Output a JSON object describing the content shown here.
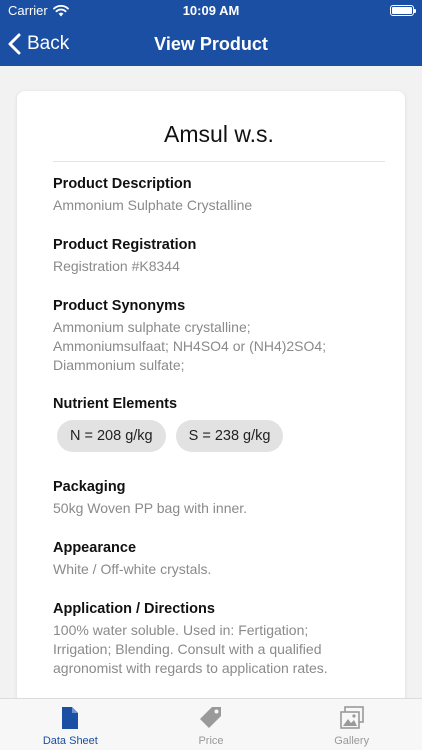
{
  "status_bar": {
    "carrier": "Carrier",
    "time": "10:09 AM"
  },
  "nav": {
    "back_label": "Back",
    "title": "View Product"
  },
  "product": {
    "name": "Amsul w.s.",
    "sections": {
      "description": {
        "label": "Product Description",
        "value": "Ammonium Sulphate Crystalline"
      },
      "registration": {
        "label": "Product Registration",
        "value": "Registration #K8344"
      },
      "synonyms": {
        "label": "Product Synonyms",
        "lines": [
          "Ammonium sulphate crystalline;",
          "Ammoniumsulfaat; NH4SO4 or (NH4)2SO4;",
          "Diammonium sulfate;"
        ]
      },
      "nutrients": {
        "label": "Nutrient Elements",
        "items": [
          "N = 208 g/kg",
          "S = 238 g/kg"
        ]
      },
      "packaging": {
        "label": "Packaging",
        "value": "50kg Woven PP bag with inner."
      },
      "appearance": {
        "label": "Appearance",
        "value": "White / Off-white crystals."
      },
      "application": {
        "label": "Application / Directions",
        "lines": [
          "100% water soluble. Used in: Fertigation;",
          "Irrigation; Blending. Consult with a qualified",
          "agronomist with regards to application rates."
        ]
      }
    }
  },
  "tabs": [
    {
      "label": "Data Sheet",
      "icon": "document-icon",
      "active": true
    },
    {
      "label": "Price",
      "icon": "price-tag-icon",
      "active": false
    },
    {
      "label": "Gallery",
      "icon": "gallery-icon",
      "active": false
    }
  ],
  "colors": {
    "brand_blue": "#1a4fa3",
    "secondary_text": "#8a8a8a",
    "pill_background": "#e2e2e2",
    "inactive_tab": "#999999"
  }
}
